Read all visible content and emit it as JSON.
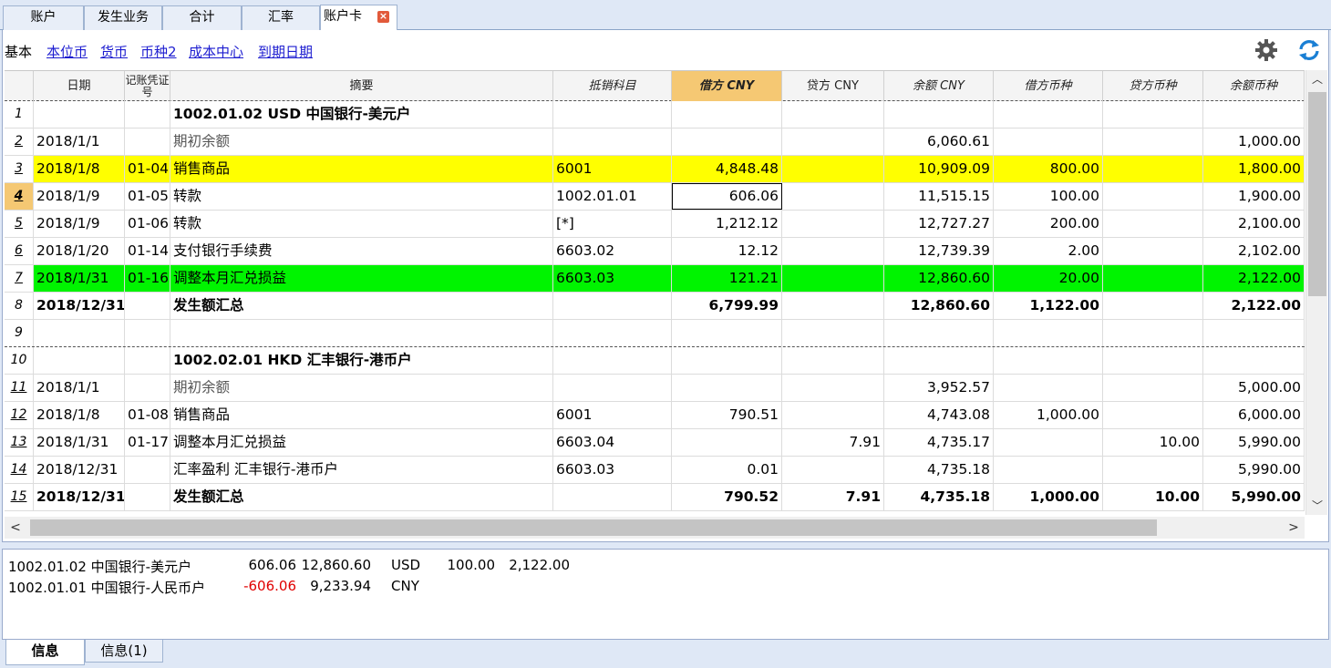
{
  "top_tabs": [
    {
      "label": "账户"
    },
    {
      "label": "发生业务"
    },
    {
      "label": "合计"
    },
    {
      "label": "汇率"
    },
    {
      "label": "账户卡"
    }
  ],
  "views": [
    "基本",
    "本位币",
    "货币",
    "币种2",
    "成本中心",
    "到期日期"
  ],
  "columns": [
    "日期",
    "记账凭证号",
    "摘要",
    "抵销科目",
    "借方 CNY",
    "贷方 CNY",
    "余额 CNY",
    "借方币种",
    "贷方币种",
    "余额币种"
  ],
  "rows": [
    {
      "n": "1",
      "date": "",
      "doc": "",
      "desc": "1002.01.02 USD 中国银行-美元户",
      "contra": "",
      "debit": "",
      "credit": "",
      "balance": "",
      "debit_cur": "",
      "credit_cur": "",
      "balance_cur": ""
    },
    {
      "n": "2",
      "date": "2018/1/1",
      "doc": "",
      "desc": "期初余额",
      "contra": "",
      "debit": "",
      "credit": "",
      "balance": "6,060.61",
      "debit_cur": "",
      "credit_cur": "",
      "balance_cur": "1,000.00"
    },
    {
      "n": "3",
      "date": "2018/1/8",
      "doc": "01-04",
      "desc": "销售商品",
      "contra": "6001",
      "debit": "4,848.48",
      "credit": "",
      "balance": "10,909.09",
      "debit_cur": "800.00",
      "credit_cur": "",
      "balance_cur": "1,800.00"
    },
    {
      "n": "4",
      "date": "2018/1/9",
      "doc": "01-05",
      "desc": "转款",
      "contra": "1002.01.01",
      "debit": "606.06",
      "credit": "",
      "balance": "11,515.15",
      "debit_cur": "100.00",
      "credit_cur": "",
      "balance_cur": "1,900.00"
    },
    {
      "n": "5",
      "date": "2018/1/9",
      "doc": "01-06",
      "desc": "转款",
      "contra": "[*]",
      "debit": "1,212.12",
      "credit": "",
      "balance": "12,727.27",
      "debit_cur": "200.00",
      "credit_cur": "",
      "balance_cur": "2,100.00"
    },
    {
      "n": "6",
      "date": "2018/1/20",
      "doc": "01-14",
      "desc": "支付银行手续费",
      "contra": "6603.02",
      "debit": "12.12",
      "credit": "",
      "balance": "12,739.39",
      "debit_cur": "2.00",
      "credit_cur": "",
      "balance_cur": "2,102.00"
    },
    {
      "n": "7",
      "date": "2018/1/31",
      "doc": "01-16",
      "desc": "调整本月汇兑损益",
      "contra": "6603.03",
      "debit": "121.21",
      "credit": "",
      "balance": "12,860.60",
      "debit_cur": "20.00",
      "credit_cur": "",
      "balance_cur": "2,122.00"
    },
    {
      "n": "8",
      "date": "2018/12/31",
      "doc": "",
      "desc": "发生额汇总",
      "contra": "",
      "debit": "6,799.99",
      "credit": "",
      "balance": "12,860.60",
      "debit_cur": "1,122.00",
      "credit_cur": "",
      "balance_cur": "2,122.00"
    },
    {
      "n": "9",
      "date": "",
      "doc": "",
      "desc": "",
      "contra": "",
      "debit": "",
      "credit": "",
      "balance": "",
      "debit_cur": "",
      "credit_cur": "",
      "balance_cur": ""
    },
    {
      "n": "10",
      "date": "",
      "doc": "",
      "desc": "1002.02.01 HKD 汇丰银行-港币户",
      "contra": "",
      "debit": "",
      "credit": "",
      "balance": "",
      "debit_cur": "",
      "credit_cur": "",
      "balance_cur": ""
    },
    {
      "n": "11",
      "date": "2018/1/1",
      "doc": "",
      "desc": "期初余额",
      "contra": "",
      "debit": "",
      "credit": "",
      "balance": "3,952.57",
      "debit_cur": "",
      "credit_cur": "",
      "balance_cur": "5,000.00"
    },
    {
      "n": "12",
      "date": "2018/1/8",
      "doc": "01-08",
      "desc": "销售商品",
      "contra": "6001",
      "debit": "790.51",
      "credit": "",
      "balance": "4,743.08",
      "debit_cur": "1,000.00",
      "credit_cur": "",
      "balance_cur": "6,000.00"
    },
    {
      "n": "13",
      "date": "2018/1/31",
      "doc": "01-17",
      "desc": "调整本月汇兑损益",
      "contra": "6603.04",
      "debit": "",
      "credit": "7.91",
      "balance": "4,735.17",
      "debit_cur": "",
      "credit_cur": "10.00",
      "balance_cur": "5,990.00"
    },
    {
      "n": "14",
      "date": "2018/12/31",
      "doc": "",
      "desc": "汇率盈利 汇丰银行-港币户",
      "contra": "6603.03",
      "debit": "0.01",
      "credit": "",
      "balance": "4,735.18",
      "debit_cur": "",
      "credit_cur": "",
      "balance_cur": "5,990.00"
    },
    {
      "n": "15",
      "date": "2018/12/31",
      "doc": "",
      "desc": "发生额汇总",
      "contra": "",
      "debit": "790.52",
      "credit": "7.91",
      "balance": "4,735.18",
      "debit_cur": "1,000.00",
      "credit_cur": "10.00",
      "balance_cur": "5,990.00"
    }
  ],
  "info": [
    {
      "account": "1002.01.02 中国银行-美元户",
      "amount": "606.06",
      "balance": "12,860.60",
      "currency": "USD",
      "cur_amount": "100.00",
      "cur_balance": "2,122.00"
    },
    {
      "account": "1002.01.01 中国银行-人民币户",
      "amount": "-606.06",
      "balance": "9,233.94",
      "currency": "CNY",
      "cur_amount": "",
      "cur_balance": ""
    }
  ],
  "bottom_tabs": [
    {
      "label": "信息"
    },
    {
      "label": "信息(1)"
    }
  ],
  "colors": {
    "highlight_yellow": "#ffff00",
    "highlight_green": "#00f400",
    "sorted_header": "#f5c873",
    "negative": "#e00000"
  }
}
